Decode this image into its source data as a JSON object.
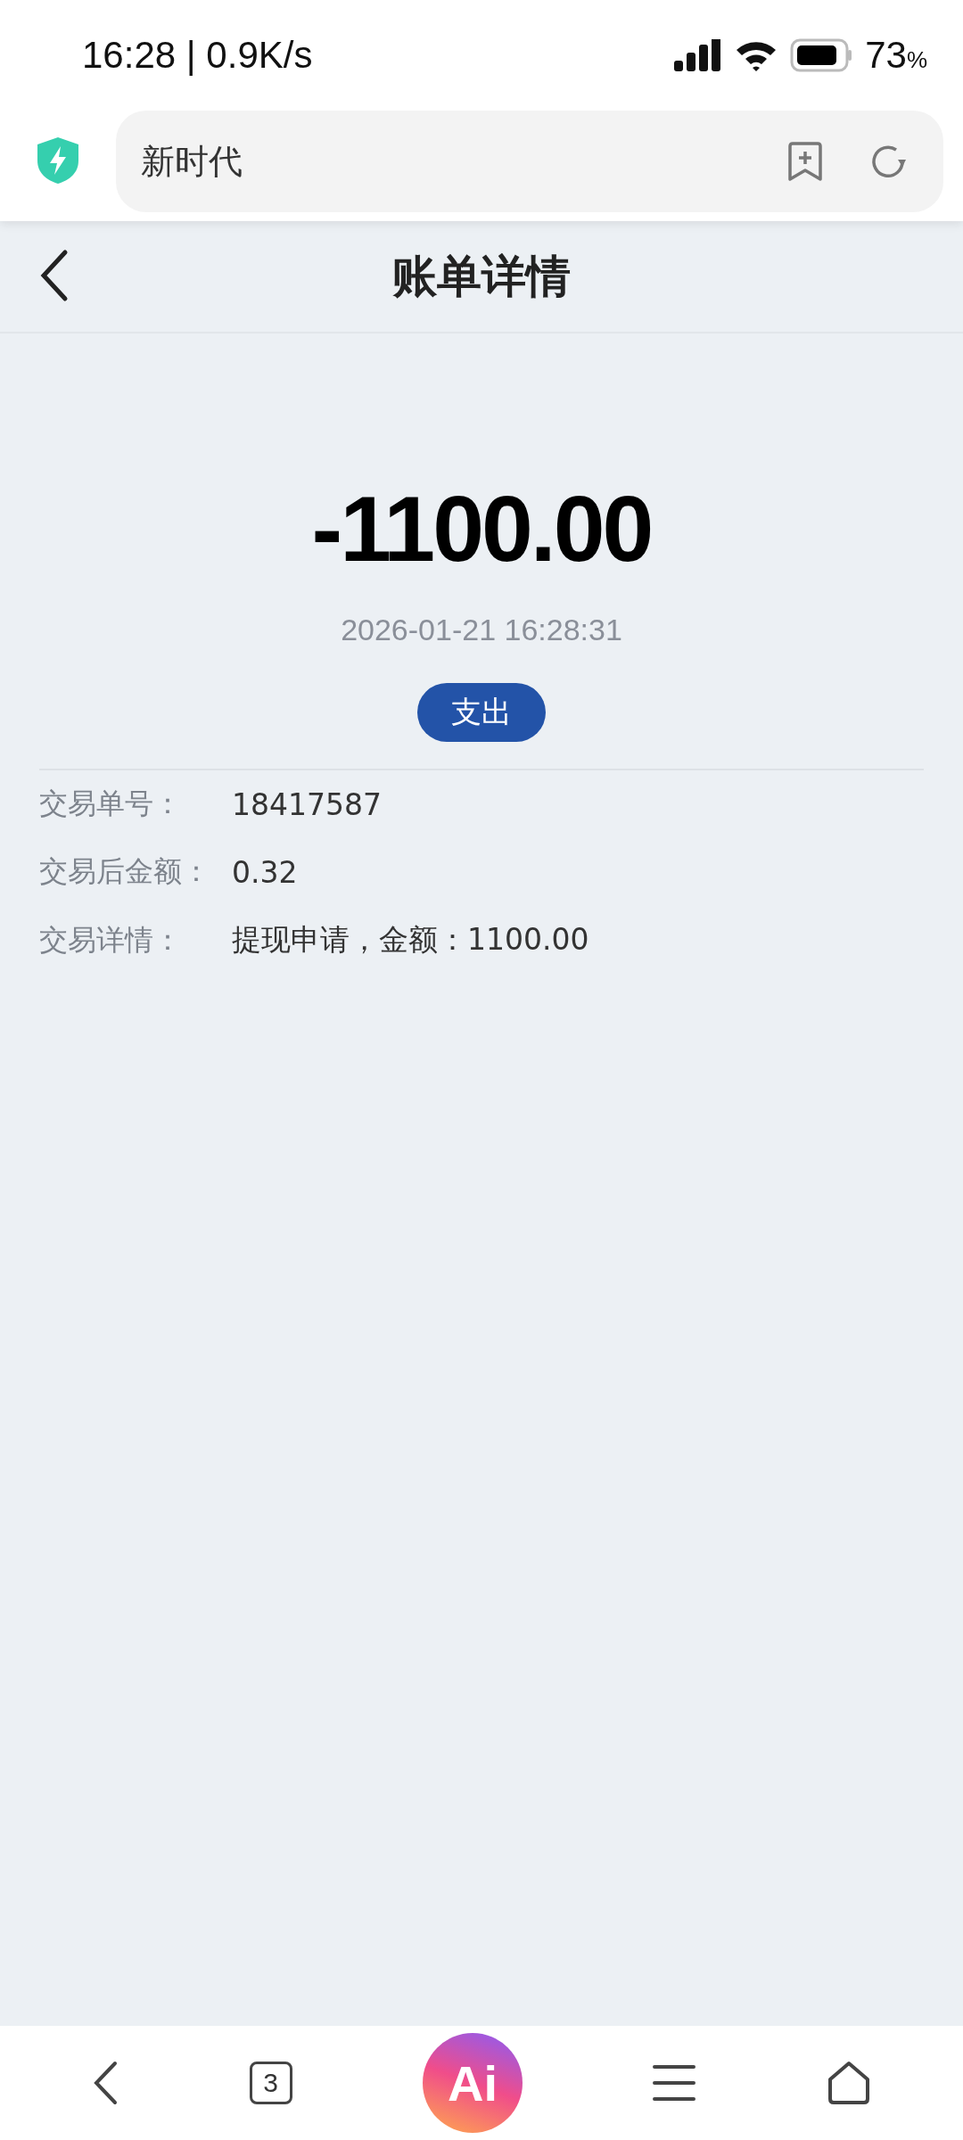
{
  "status_bar": {
    "time": "16:28 | 0.9K/s",
    "battery": "73",
    "battery_unit": "%"
  },
  "address_bar": {
    "text": "新时代"
  },
  "header": {
    "title": "账单详情"
  },
  "amount": "-1100.00",
  "datetime": "2026-01-21 16:28:31",
  "badge": "支出",
  "details": [
    {
      "label": "交易单号：",
      "value": "18417587"
    },
    {
      "label": "交易后金额：",
      "value": "0.32"
    },
    {
      "label": "交易详情：",
      "value": "提现申请，金额：1100.00"
    }
  ],
  "bottom_nav": {
    "tab_count": "3",
    "ai_label": "Ai"
  }
}
